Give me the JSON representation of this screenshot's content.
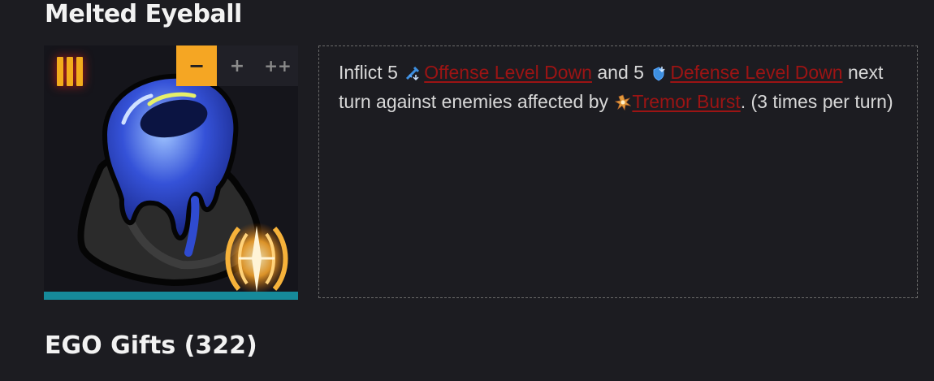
{
  "gift": {
    "name": "Melted Eyeball",
    "tier": "III",
    "upgrades": [
      "−",
      "+",
      "++"
    ],
    "colors": {
      "accent": "#f5a623",
      "keyword": "#9c1414",
      "bar": "#168a9a"
    },
    "description": {
      "p1": "Inflict 5",
      "kw1": "Offense Level Down",
      "p2": "and 5",
      "kw2": "Defense Level Down",
      "p3": "next turn against enemies affected by",
      "kw3": "Tremor Burst",
      "p4": ". (3 times per turn)"
    },
    "icons": [
      "offense-level-down-icon",
      "defense-level-down-icon",
      "tremor-burst-icon",
      "tremor-keyword-icon",
      "melted-eyeball-art"
    ]
  },
  "section": {
    "title": "EGO Gifts (322)"
  }
}
